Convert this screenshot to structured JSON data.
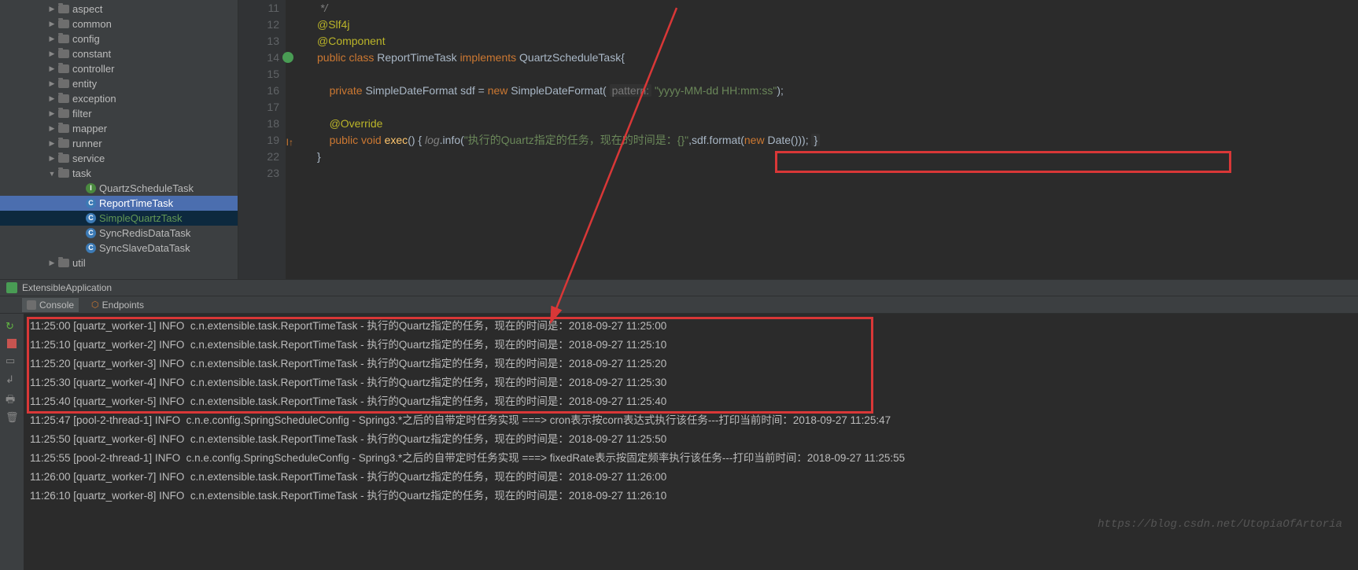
{
  "sidebar": {
    "items": [
      {
        "indent": 60,
        "arrow": "▶",
        "type": "folder",
        "label": "aspect"
      },
      {
        "indent": 60,
        "arrow": "▶",
        "type": "folder",
        "label": "common"
      },
      {
        "indent": 60,
        "arrow": "▶",
        "type": "folder",
        "label": "config"
      },
      {
        "indent": 60,
        "arrow": "▶",
        "type": "folder",
        "label": "constant"
      },
      {
        "indent": 60,
        "arrow": "▶",
        "type": "folder",
        "label": "controller"
      },
      {
        "indent": 60,
        "arrow": "▶",
        "type": "folder",
        "label": "entity"
      },
      {
        "indent": 60,
        "arrow": "▶",
        "type": "folder",
        "label": "exception"
      },
      {
        "indent": 60,
        "arrow": "▶",
        "type": "folder",
        "label": "filter"
      },
      {
        "indent": 60,
        "arrow": "▶",
        "type": "folder",
        "label": "mapper"
      },
      {
        "indent": 60,
        "arrow": "▶",
        "type": "folder",
        "label": "runner"
      },
      {
        "indent": 60,
        "arrow": "▶",
        "type": "folder",
        "label": "service"
      },
      {
        "indent": 60,
        "arrow": "▼",
        "type": "folder",
        "label": "task"
      },
      {
        "indent": 95,
        "arrow": "",
        "type": "interface",
        "label": "QuartzScheduleTask"
      },
      {
        "indent": 95,
        "arrow": "",
        "type": "class",
        "label": "ReportTimeTask",
        "selected": true
      },
      {
        "indent": 95,
        "arrow": "",
        "type": "class",
        "label": "SimpleQuartzTask",
        "green": true,
        "sel2": true
      },
      {
        "indent": 95,
        "arrow": "",
        "type": "class",
        "label": "SyncRedisDataTask"
      },
      {
        "indent": 95,
        "arrow": "",
        "type": "class",
        "label": "SyncSlaveDataTask"
      },
      {
        "indent": 60,
        "arrow": "▶",
        "type": "folder",
        "label": "util"
      }
    ]
  },
  "editor": {
    "lines": [
      {
        "n": 11,
        "html": " */",
        "cls": "com"
      },
      {
        "n": 12,
        "html": "@Slf4j",
        "cls": "ann"
      },
      {
        "n": 13,
        "html": "@Component",
        "cls": "ann"
      },
      {
        "n": 14,
        "html": "<span class='kw'>public class </span><span class='cls'>ReportTimeTask </span><span class='kw'>implements </span><span class='cls'>QuartzScheduleTask{</span>",
        "mark": "green"
      },
      {
        "n": 15,
        "html": ""
      },
      {
        "n": 16,
        "html": "    <span class='kw'>private </span>SimpleDateFormat sdf = <span class='kw'>new </span>SimpleDateFormat( <span class='hint gray-bg'>pattern:</span> <span class='str'>\"yyyy-MM-dd HH:mm:ss\"</span>);"
      },
      {
        "n": 17,
        "html": ""
      },
      {
        "n": 18,
        "html": "    <span class='ann'>@Override</span>"
      },
      {
        "n": 19,
        "html": "    <span class='kw'>public void </span><span class='method'>exec</span>() { <span class='com' style='font-style:italic'>log</span>.info(<span class='str'>\"执行的Quartz指定的任务，现在的时间是：{}\"</span>,sdf.format(<span class='kw'>new </span>Date())); <span class='gray-bg'>}</span>",
        "mark": "impl"
      },
      {
        "n": 22,
        "html": "}"
      },
      {
        "n": 23,
        "html": ""
      }
    ]
  },
  "runTab": {
    "label": "ExtensibleApplication"
  },
  "toolTabs": {
    "console": "Console",
    "endpoints": "Endpoints"
  },
  "console": {
    "lines": [
      "11:25:00 [quartz_worker-1] INFO  c.n.extensible.task.ReportTimeTask - 执行的Quartz指定的任务，现在的时间是：2018-09-27 11:25:00",
      "11:25:10 [quartz_worker-2] INFO  c.n.extensible.task.ReportTimeTask - 执行的Quartz指定的任务，现在的时间是：2018-09-27 11:25:10",
      "11:25:20 [quartz_worker-3] INFO  c.n.extensible.task.ReportTimeTask - 执行的Quartz指定的任务，现在的时间是：2018-09-27 11:25:20",
      "11:25:30 [quartz_worker-4] INFO  c.n.extensible.task.ReportTimeTask - 执行的Quartz指定的任务，现在的时间是：2018-09-27 11:25:30",
      "11:25:40 [quartz_worker-5] INFO  c.n.extensible.task.ReportTimeTask - 执行的Quartz指定的任务，现在的时间是：2018-09-27 11:25:40",
      "11:25:47 [pool-2-thread-1] INFO  c.n.e.config.SpringScheduleConfig - Spring3.*之后的自带定时任务实现 ===> cron表示按corn表达式执行该任务---打印当前时间：2018-09-27 11:25:47",
      "11:25:50 [quartz_worker-6] INFO  c.n.extensible.task.ReportTimeTask - 执行的Quartz指定的任务，现在的时间是：2018-09-27 11:25:50",
      "11:25:55 [pool-2-thread-1] INFO  c.n.e.config.SpringScheduleConfig - Spring3.*之后的自带定时任务实现 ===> fixedRate表示按固定频率执行该任务---打印当前时间：2018-09-27 11:25:55",
      "11:26:00 [quartz_worker-7] INFO  c.n.extensible.task.ReportTimeTask - 执行的Quartz指定的任务，现在的时间是：2018-09-27 11:26:00",
      "11:26:10 [quartz_worker-8] INFO  c.n.extensible.task.ReportTimeTask - 执行的Quartz指定的任务，现在的时间是：2018-09-27 11:26:10"
    ]
  },
  "watermark": "https://blog.csdn.net/UtopiaOfArtoria"
}
